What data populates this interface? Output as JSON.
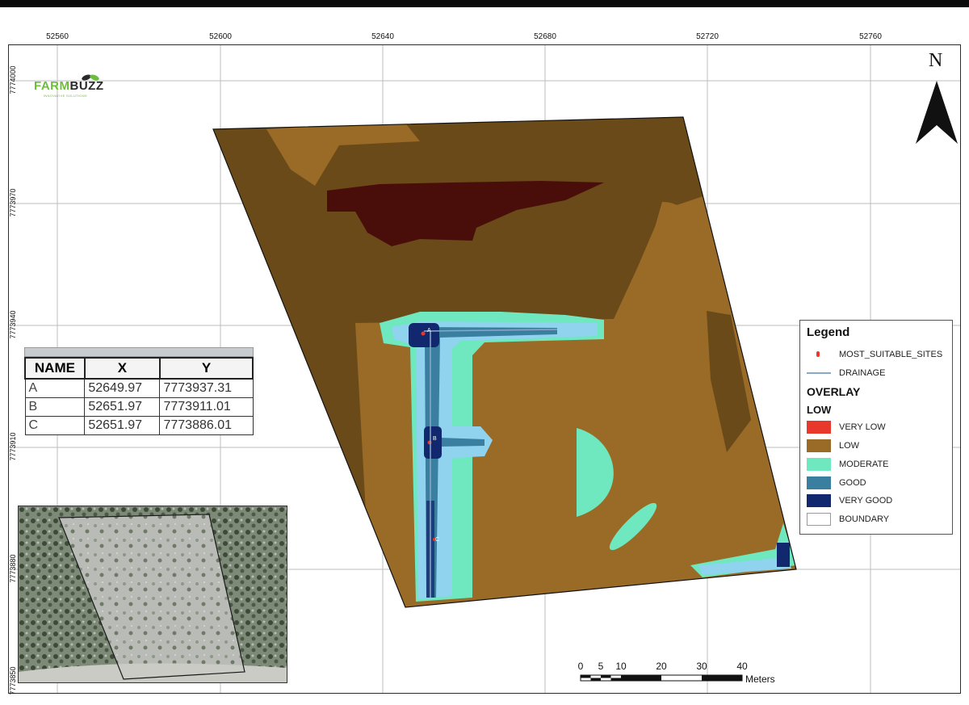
{
  "map": {
    "logo": {
      "farm": "FARM",
      "buzz": "BUZZ",
      "tagline": "INNOVATIVE SOLUTIONS"
    },
    "north_label": "N",
    "x_ticks": [
      "52560",
      "52600",
      "52640",
      "52680",
      "52720",
      "52760"
    ],
    "y_ticks": [
      "7774000",
      "7773970",
      "7773940",
      "7773910",
      "7773880",
      "7773850"
    ],
    "legend": {
      "title": "Legend",
      "sites_label": "MOST_SUITABLE_SITES",
      "drainage_label": "DRAINAGE",
      "overlay_title": "OVERLAY",
      "overlay_sub": "LOW",
      "classes": [
        {
          "label": "VERY LOW",
          "color": "#e8382b"
        },
        {
          "label": "LOW",
          "color": "#9a6b27"
        },
        {
          "label": "MODERATE",
          "color": "#6fe8c0"
        },
        {
          "label": "GOOD",
          "color": "#3a7fa0"
        },
        {
          "label": "VERY GOOD",
          "color": "#12286e"
        },
        {
          "label": "BOUNDARY",
          "color": "#ffffff"
        }
      ]
    },
    "table": {
      "headers": [
        "NAME",
        "X",
        "Y"
      ],
      "rows": [
        [
          "A",
          "52649.97",
          "7773937.31"
        ],
        [
          "B",
          "52651.97",
          "7773911.01"
        ],
        [
          "C",
          "52651.97",
          "7773886.01"
        ]
      ]
    },
    "scale": {
      "labels": [
        "0",
        "5",
        "10",
        "20",
        "30",
        "40"
      ],
      "unit": "Meters"
    },
    "colors": {
      "dark_brown": "#6b4a1a",
      "low": "#9a6b27",
      "very_low_dark": "#4a0e0a",
      "moderate": "#6fe8c0",
      "light_blue": "#8fd3ee",
      "good": "#3a7fa0",
      "very_good": "#12286e"
    }
  }
}
